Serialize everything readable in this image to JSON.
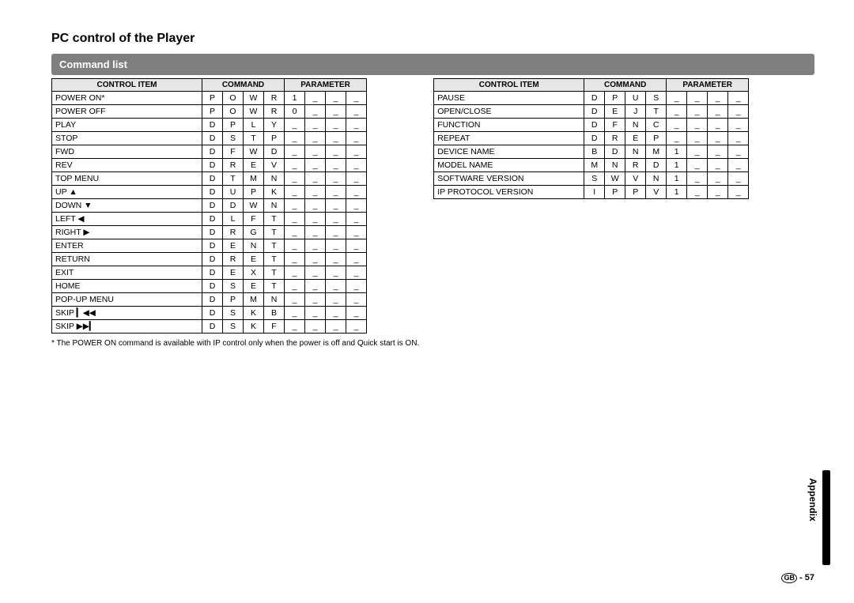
{
  "title": "PC control of the Player",
  "subtitle": "Command list",
  "headers": {
    "item": "CONTROL ITEM",
    "command": "COMMAND",
    "parameter": "PARAMETER"
  },
  "left": [
    {
      "name": "POWER ON*",
      "c": [
        "P",
        "O",
        "W",
        "R"
      ],
      "p": [
        "1",
        "_",
        "_",
        "_"
      ]
    },
    {
      "name": "POWER OFF",
      "c": [
        "P",
        "O",
        "W",
        "R"
      ],
      "p": [
        "0",
        "_",
        "_",
        "_"
      ]
    },
    {
      "name": "PLAY",
      "c": [
        "D",
        "P",
        "L",
        "Y"
      ],
      "p": [
        "_",
        "_",
        "_",
        "_"
      ]
    },
    {
      "name": "STOP",
      "c": [
        "D",
        "S",
        "T",
        "P"
      ],
      "p": [
        "_",
        "_",
        "_",
        "_"
      ]
    },
    {
      "name": "FWD",
      "c": [
        "D",
        "F",
        "W",
        "D"
      ],
      "p": [
        "_",
        "_",
        "_",
        "_"
      ]
    },
    {
      "name": "REV",
      "c": [
        "D",
        "R",
        "E",
        "V"
      ],
      "p": [
        "_",
        "_",
        "_",
        "_"
      ]
    },
    {
      "name": "TOP MENU",
      "c": [
        "D",
        "T",
        "M",
        "N"
      ],
      "p": [
        "_",
        "_",
        "_",
        "_"
      ]
    },
    {
      "name": "UP",
      "icon": "▲",
      "c": [
        "D",
        "U",
        "P",
        "K"
      ],
      "p": [
        "_",
        "_",
        "_",
        "_"
      ]
    },
    {
      "name": "DOWN",
      "icon": "▼",
      "c": [
        "D",
        "D",
        "W",
        "N"
      ],
      "p": [
        "_",
        "_",
        "_",
        "_"
      ]
    },
    {
      "name": "LEFT",
      "icon": "◀",
      "c": [
        "D",
        "L",
        "F",
        "T"
      ],
      "p": [
        "_",
        "_",
        "_",
        "_"
      ]
    },
    {
      "name": "RIGHT",
      "icon": "▶",
      "c": [
        "D",
        "R",
        "G",
        "T"
      ],
      "p": [
        "_",
        "_",
        "_",
        "_"
      ]
    },
    {
      "name": "ENTER",
      "c": [
        "D",
        "E",
        "N",
        "T"
      ],
      "p": [
        "_",
        "_",
        "_",
        "_"
      ]
    },
    {
      "name": "RETURN",
      "c": [
        "D",
        "R",
        "E",
        "T"
      ],
      "p": [
        "_",
        "_",
        "_",
        "_"
      ]
    },
    {
      "name": "EXIT",
      "c": [
        "D",
        "E",
        "X",
        "T"
      ],
      "p": [
        "_",
        "_",
        "_",
        "_"
      ]
    },
    {
      "name": "HOME",
      "c": [
        "D",
        "S",
        "E",
        "T"
      ],
      "p": [
        "_",
        "_",
        "_",
        "_"
      ]
    },
    {
      "name": "POP-UP MENU",
      "c": [
        "D",
        "P",
        "M",
        "N"
      ],
      "p": [
        "_",
        "_",
        "_",
        "_"
      ]
    },
    {
      "name": "SKIP",
      "icon": "⏮◀",
      "c": [
        "D",
        "S",
        "K",
        "B"
      ],
      "p": [
        "_",
        "_",
        "_",
        "_"
      ]
    },
    {
      "name": "SKIP",
      "icon": "▶⏭",
      "c": [
        "D",
        "S",
        "K",
        "F"
      ],
      "p": [
        "_",
        "_",
        "_",
        "_"
      ]
    }
  ],
  "right": [
    {
      "name": "PAUSE",
      "c": [
        "D",
        "P",
        "U",
        "S"
      ],
      "p": [
        "_",
        "_",
        "_",
        "_"
      ]
    },
    {
      "name": "OPEN/CLOSE",
      "c": [
        "D",
        "E",
        "J",
        "T"
      ],
      "p": [
        "_",
        "_",
        "_",
        "_"
      ]
    },
    {
      "name": "FUNCTION",
      "c": [
        "D",
        "F",
        "N",
        "C"
      ],
      "p": [
        "_",
        "_",
        "_",
        "_"
      ]
    },
    {
      "name": "REPEAT",
      "c": [
        "D",
        "R",
        "E",
        "P"
      ],
      "p": [
        "_",
        "_",
        "_",
        "_"
      ]
    },
    {
      "name": "DEVICE NAME",
      "c": [
        "B",
        "D",
        "N",
        "M"
      ],
      "p": [
        "1",
        "_",
        "_",
        "_"
      ]
    },
    {
      "name": "MODEL NAME",
      "c": [
        "M",
        "N",
        "R",
        "D"
      ],
      "p": [
        "1",
        "_",
        "_",
        "_"
      ]
    },
    {
      "name": "SOFTWARE VERSION",
      "c": [
        "S",
        "W",
        "V",
        "N"
      ],
      "p": [
        "1",
        "_",
        "_",
        "_"
      ]
    },
    {
      "name": "IP PROTOCOL VERSION",
      "c": [
        "I",
        "P",
        "P",
        "V"
      ],
      "p": [
        "1",
        "_",
        "_",
        "_"
      ]
    }
  ],
  "footnote": "* The POWER ON command is available with IP control only when the power is off and Quick start is ON.",
  "sideLabel": "Appendix",
  "pageNumber": "57",
  "pagePrefix": "GB"
}
